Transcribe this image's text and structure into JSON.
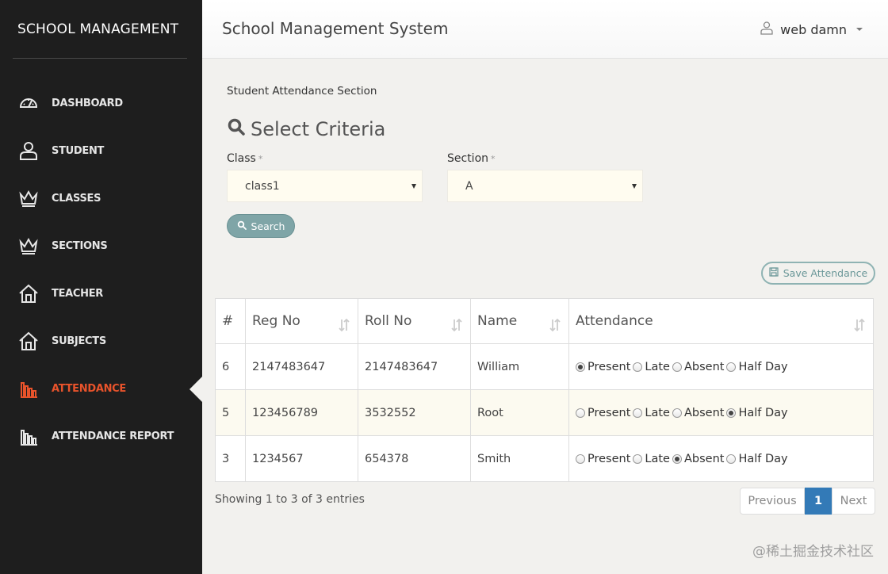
{
  "sidebar": {
    "brand": "SCHOOL MANAGEMENT",
    "items": [
      {
        "label": "DASHBOARD",
        "icon": "dashboard-icon"
      },
      {
        "label": "STUDENT",
        "icon": "user-icon"
      },
      {
        "label": "CLASSES",
        "icon": "crown-icon"
      },
      {
        "label": "SECTIONS",
        "icon": "crown-icon"
      },
      {
        "label": "TEACHER",
        "icon": "home-icon"
      },
      {
        "label": "SUBJECTS",
        "icon": "home-icon"
      },
      {
        "label": "ATTENDANCE",
        "icon": "bar-chart-icon",
        "active": true
      },
      {
        "label": "ATTENDANCE REPORT",
        "icon": "bar-chart-icon"
      }
    ],
    "active_color": "#e8532b"
  },
  "header": {
    "title": "School Management System",
    "user_name": "web damn"
  },
  "main": {
    "section_title": "Student Attendance Section",
    "criteria_title": "Select Criteria",
    "class_field": {
      "label": "Class",
      "required": "*",
      "value": "class1"
    },
    "section_field": {
      "label": "Section",
      "required": "*",
      "value": "A"
    },
    "search_button": "Search",
    "save_button": "Save Attendance"
  },
  "table": {
    "columns": [
      "#",
      "Reg No",
      "Roll No",
      "Name",
      "Attendance"
    ],
    "attendance_options": [
      "Present",
      "Late",
      "Absent",
      "Half Day"
    ],
    "rows": [
      {
        "num": "6",
        "reg_no": "2147483647",
        "roll_no": "2147483647",
        "name": "William",
        "attendance": "Present"
      },
      {
        "num": "5",
        "reg_no": "123456789",
        "roll_no": "3532552",
        "name": "Root",
        "attendance": "Half Day"
      },
      {
        "num": "3",
        "reg_no": "1234567",
        "roll_no": "654378",
        "name": "Smith",
        "attendance": "Absent"
      }
    ]
  },
  "footer": {
    "info": "Showing 1 to 3 of 3 entries",
    "prev": "Previous",
    "page": "1",
    "next": "Next"
  },
  "watermark": "@稀土掘金技术社区"
}
